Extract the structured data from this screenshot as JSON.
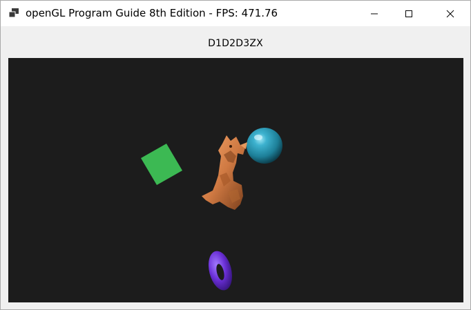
{
  "window": {
    "title": "openGL Program Guide 8th Edition - FPS: 471.76",
    "app_icon": "app-window-icon",
    "controls": {
      "minimize_icon": "minimize-icon",
      "maximize_icon": "maximize-icon",
      "close_icon": "close-icon"
    }
  },
  "client": {
    "label": "D1D2D3ZX"
  },
  "scene": {
    "background_color": "#1c1c1c",
    "objects": [
      {
        "name": "green-cube",
        "color": "#3cb953"
      },
      {
        "name": "dragon-model",
        "color": "#d8844c"
      },
      {
        "name": "cyan-sphere",
        "color": "#2a9ab5"
      },
      {
        "name": "purple-torus",
        "color": "#6a2fd6"
      }
    ]
  }
}
